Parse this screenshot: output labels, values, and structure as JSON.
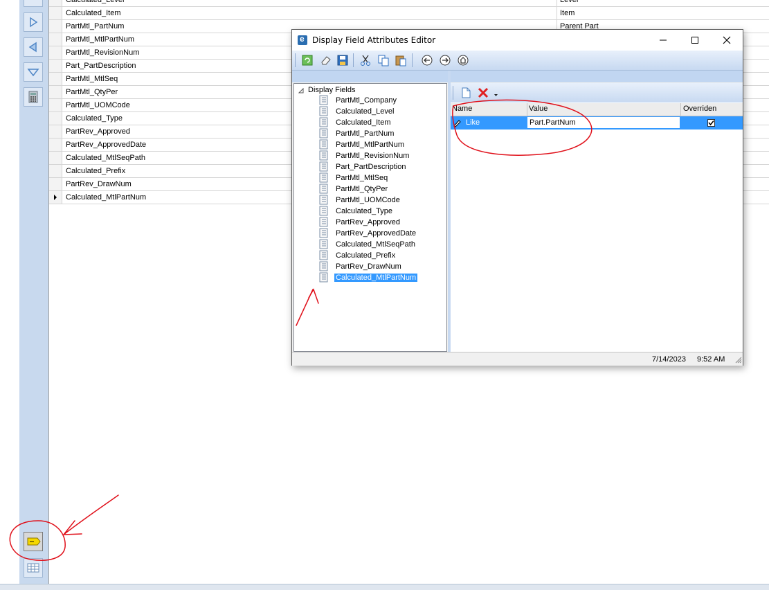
{
  "background_grid": {
    "rows": [
      {
        "field": "Calculated_Level",
        "value": "Level"
      },
      {
        "field": "Calculated_Item",
        "value": "Item"
      },
      {
        "field": "PartMtl_PartNum",
        "value": "Parent Part"
      },
      {
        "field": "PartMtl_MtlPartNum",
        "value": ""
      },
      {
        "field": "PartMtl_RevisionNum",
        "value": ""
      },
      {
        "field": "Part_PartDescription",
        "value": ""
      },
      {
        "field": "PartMtl_MtlSeq",
        "value": ""
      },
      {
        "field": "PartMtl_QtyPer",
        "value": ""
      },
      {
        "field": "PartMtl_UOMCode",
        "value": ""
      },
      {
        "field": "Calculated_Type",
        "value": ""
      },
      {
        "field": "PartRev_Approved",
        "value": ""
      },
      {
        "field": "PartRev_ApprovedDate",
        "value": ""
      },
      {
        "field": "Calculated_MtlSeqPath",
        "value": ""
      },
      {
        "field": "Calculated_Prefix",
        "value": ""
      },
      {
        "field": "PartRev_DrawNum",
        "value": ""
      },
      {
        "field": "Calculated_MtlPartNum",
        "value": "",
        "current": true
      }
    ]
  },
  "dialog": {
    "title": "Display Field Attributes Editor",
    "app_logo_letter": "e",
    "window_controls": {
      "minimize": "minimize-icon",
      "maximize": "maximize-icon",
      "close": "close-icon"
    },
    "toolbar_icons": [
      "refresh-icon",
      "eraser-icon",
      "save-icon",
      "cut-icon",
      "copy-icon",
      "paste-icon",
      "back-icon",
      "forward-icon",
      "home-icon"
    ],
    "tree": {
      "root_label": "Display Fields",
      "items": [
        "PartMtl_Company",
        "Calculated_Level",
        "Calculated_Item",
        "PartMtl_PartNum",
        "PartMtl_MtlPartNum",
        "PartMtl_RevisionNum",
        "Part_PartDescription",
        "PartMtl_MtlSeq",
        "PartMtl_QtyPer",
        "PartMtl_UOMCode",
        "Calculated_Type",
        "PartRev_Approved",
        "PartRev_ApprovedDate",
        "Calculated_MtlSeqPath",
        "Calculated_Prefix",
        "PartRev_DrawNum",
        "Calculated_MtlPartNum"
      ],
      "selected": "Calculated_MtlPartNum"
    },
    "properties": {
      "headers": {
        "name": "Name",
        "value": "Value",
        "overriden": "Overriden"
      },
      "rows": [
        {
          "name": "Like",
          "value": "Part.PartNum",
          "overriden": true
        }
      ]
    },
    "status": {
      "date": "7/14/2023",
      "time": "9:52 AM"
    }
  },
  "colors": {
    "selection": "#3399ff",
    "toolbar_blue": "#c7d9f1",
    "annotation_red": "#e0101a"
  }
}
